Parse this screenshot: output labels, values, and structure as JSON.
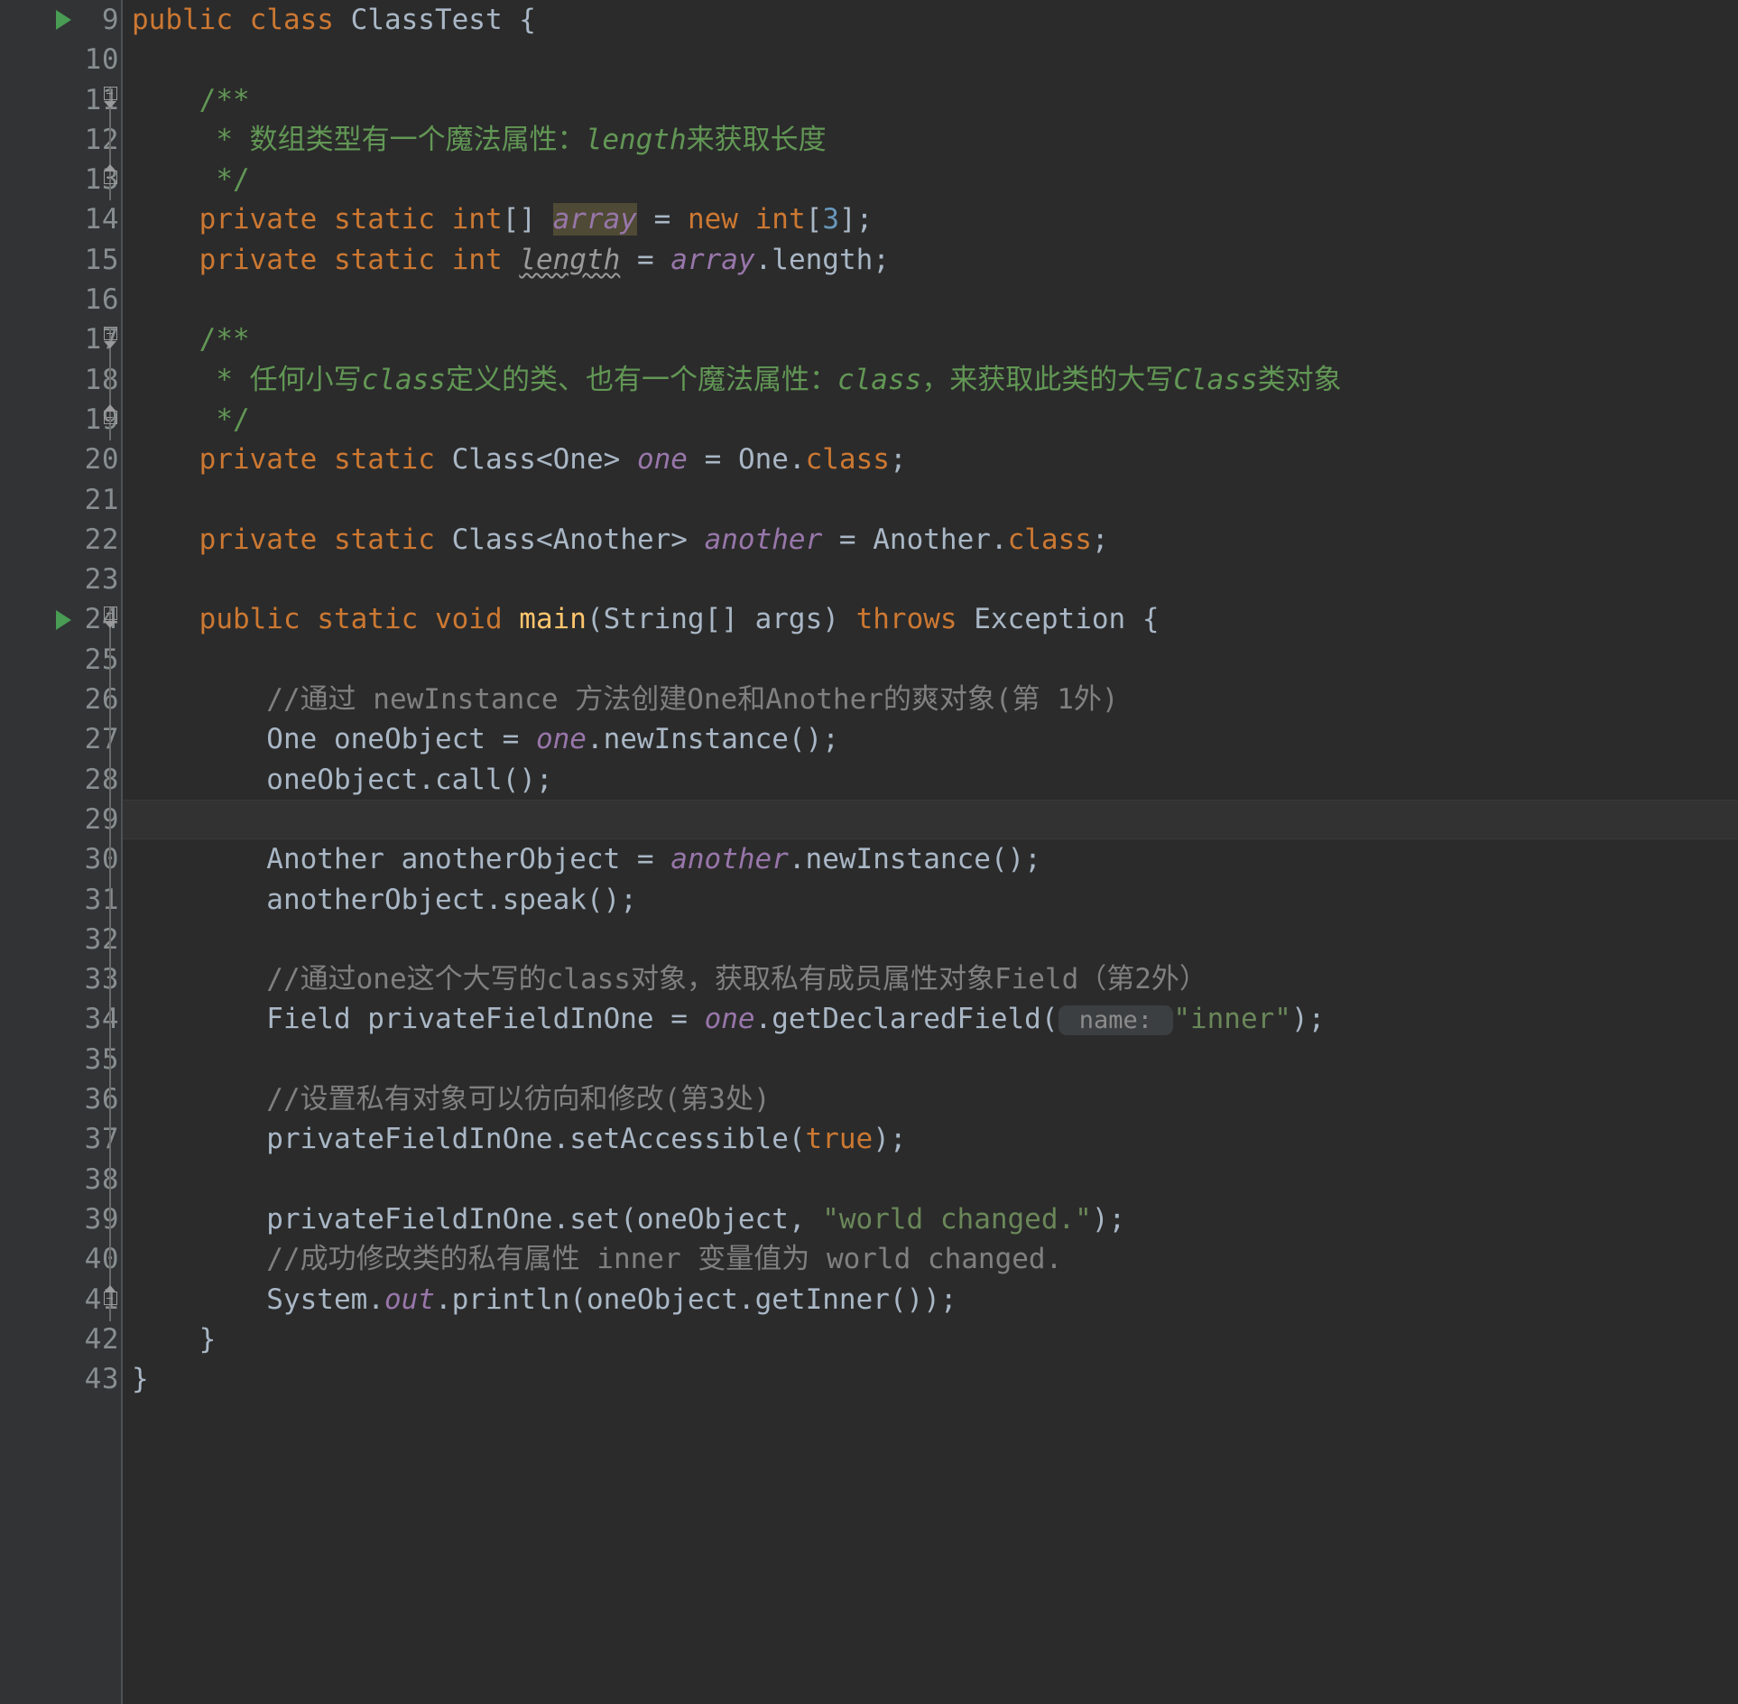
{
  "app": {
    "kind": "code-editor",
    "language": "Java",
    "theme": "Darcula",
    "class_name": "ClassTest"
  },
  "colors": {
    "background": "#2b2b2b",
    "gutter_background": "#313335",
    "line_number": "#888e8f",
    "default_text": "#a9b7c6",
    "keyword": "#cc7832",
    "number": "#6897bb",
    "string": "#6a8759",
    "line_comment": "#808080",
    "doc_comment": "#629755",
    "field_identifier": "#9876aa",
    "method_highlight": "#ffc66d",
    "identifier_highlight_bg": "#4e4a35",
    "run_marker_green": "#499c54",
    "caret_row_bg": "#323232",
    "inlay_hint_bg": "#3c3f41",
    "inlay_hint_text": "#8c8c8c"
  },
  "gutter": {
    "line_numbers": [
      "9",
      "10",
      "11",
      "12",
      "13",
      "14",
      "15",
      "16",
      "17",
      "18",
      "19",
      "20",
      "21",
      "22",
      "23",
      "24",
      "25",
      "26",
      "27",
      "28",
      "29",
      "30",
      "31",
      "32",
      "33",
      "34",
      "35",
      "36",
      "37",
      "38",
      "39",
      "40",
      "41",
      "42",
      "43"
    ],
    "run_markers_on_lines": [
      "9",
      "24"
    ],
    "fold_regions": [
      {
        "start_line": "11",
        "end_line": "13"
      },
      {
        "start_line": "17",
        "end_line": "19"
      },
      {
        "start_line": "24",
        "end_line": "42"
      }
    ]
  },
  "code": {
    "caret_line": "29",
    "lines": [
      {
        "n": "9",
        "text": "public class ClassTest {"
      },
      {
        "n": "10",
        "text": ""
      },
      {
        "n": "11",
        "text": "    /**"
      },
      {
        "n": "12",
        "text": "     * 数组类型有一个魔法属性：length来获取长度"
      },
      {
        "n": "13",
        "text": "     */"
      },
      {
        "n": "14",
        "text": "    private static int[] array = new int[3];"
      },
      {
        "n": "15",
        "text": "    private static int length = array.length;"
      },
      {
        "n": "16",
        "text": ""
      },
      {
        "n": "17",
        "text": "    /**"
      },
      {
        "n": "18",
        "text": "     * 任何小写class定义的类、也有一个魔法属性：class，来获取此类的大写Class类对象"
      },
      {
        "n": "19",
        "text": "     */"
      },
      {
        "n": "20",
        "text": "    private static Class<One> one = One.class;"
      },
      {
        "n": "21",
        "text": ""
      },
      {
        "n": "22",
        "text": "    private static Class<Another> another = Another.class;"
      },
      {
        "n": "23",
        "text": ""
      },
      {
        "n": "24",
        "text": "    public static void main(String[] args) throws Exception {"
      },
      {
        "n": "25",
        "text": ""
      },
      {
        "n": "26",
        "text": "        //通过 newInstance 方法创建One和Another的爽对象(第 1外)"
      },
      {
        "n": "27",
        "text": "        One oneObject = one.newInstance();"
      },
      {
        "n": "28",
        "text": "        oneObject.call();"
      },
      {
        "n": "29",
        "text": ""
      },
      {
        "n": "30",
        "text": "        Another anotherObject = another.newInstance();"
      },
      {
        "n": "31",
        "text": "        anotherObject.speak();"
      },
      {
        "n": "32",
        "text": ""
      },
      {
        "n": "33",
        "text": "        //通过one这个大写的class对象，获取私有成员属性对象Field（第2外）"
      },
      {
        "n": "34",
        "text": "        Field privateFieldInOne = one.getDeclaredField( name: \"inner\");"
      },
      {
        "n": "35",
        "text": ""
      },
      {
        "n": "36",
        "text": "        //设置私有对象可以彷向和修改(第3处)"
      },
      {
        "n": "37",
        "text": "        privateFieldInOne.setAccessible(true);"
      },
      {
        "n": "38",
        "text": ""
      },
      {
        "n": "39",
        "text": "        privateFieldInOne.set(oneObject, \"world changed.\");"
      },
      {
        "n": "40",
        "text": "        //成功修改类的私有属性 inner 变量值为 world changed."
      },
      {
        "n": "41",
        "text": "        System.out.println(oneObject.getInner());"
      },
      {
        "n": "42",
        "text": "    }"
      },
      {
        "n": "43",
        "text": "}"
      }
    ]
  },
  "tokens": {
    "l9": [
      {
        "t": "public",
        "c": "kw"
      },
      {
        "t": " ",
        "c": "punc"
      },
      {
        "t": "class",
        "c": "kw"
      },
      {
        "t": " ",
        "c": "punc"
      },
      {
        "t": "ClassTest",
        "c": "cls"
      },
      {
        "t": " {",
        "c": "punc"
      }
    ],
    "l11": [
      {
        "t": "    /**",
        "c": "doc"
      }
    ],
    "l12": [
      {
        "t": "     * 数组类型有一个魔法属性：",
        "c": "doc"
      },
      {
        "t": "length",
        "c": "doc-italic"
      },
      {
        "t": "来获取长度",
        "c": "doc"
      }
    ],
    "l13": [
      {
        "t": "     */",
        "c": "doc"
      }
    ],
    "l14": [
      {
        "t": "    ",
        "c": "punc"
      },
      {
        "t": "private",
        "c": "kw"
      },
      {
        "t": " ",
        "c": "punc"
      },
      {
        "t": "static",
        "c": "kw"
      },
      {
        "t": " ",
        "c": "punc"
      },
      {
        "t": "int",
        "c": "kw"
      },
      {
        "t": "[]",
        "c": "punc"
      },
      {
        "t": " ",
        "c": "punc"
      },
      {
        "t": "array",
        "c": "fld-hl"
      },
      {
        "t": " = ",
        "c": "punc"
      },
      {
        "t": "new",
        "c": "kw"
      },
      {
        "t": " ",
        "c": "punc"
      },
      {
        "t": "int",
        "c": "kw"
      },
      {
        "t": "[",
        "c": "punc"
      },
      {
        "t": "3",
        "c": "num"
      },
      {
        "t": "];",
        "c": "punc"
      }
    ],
    "l15": [
      {
        "t": "    ",
        "c": "punc"
      },
      {
        "t": "private",
        "c": "kw"
      },
      {
        "t": " ",
        "c": "punc"
      },
      {
        "t": "static",
        "c": "kw"
      },
      {
        "t": " ",
        "c": "punc"
      },
      {
        "t": "int",
        "c": "kw"
      },
      {
        "t": " ",
        "c": "punc"
      },
      {
        "t": "length",
        "c": "unused"
      },
      {
        "t": " = ",
        "c": "punc"
      },
      {
        "t": "array",
        "c": "fld"
      },
      {
        "t": ".length;",
        "c": "punc"
      }
    ],
    "l17": [
      {
        "t": "    /**",
        "c": "doc"
      }
    ],
    "l18": [
      {
        "t": "     * 任何小写",
        "c": "doc"
      },
      {
        "t": "class",
        "c": "doc-italic"
      },
      {
        "t": "定义的类、也有一个魔法属性：",
        "c": "doc"
      },
      {
        "t": "class",
        "c": "doc-italic"
      },
      {
        "t": "，来获取此类的大写",
        "c": "doc"
      },
      {
        "t": "Class",
        "c": "doc-italic"
      },
      {
        "t": "类对象",
        "c": "doc"
      }
    ],
    "l19": [
      {
        "t": "     */",
        "c": "doc"
      }
    ],
    "l20": [
      {
        "t": "    ",
        "c": "punc"
      },
      {
        "t": "private",
        "c": "kw"
      },
      {
        "t": " ",
        "c": "punc"
      },
      {
        "t": "static",
        "c": "kw"
      },
      {
        "t": " ",
        "c": "punc"
      },
      {
        "t": "Class<One> ",
        "c": "cls"
      },
      {
        "t": "one",
        "c": "fld"
      },
      {
        "t": " = ",
        "c": "punc"
      },
      {
        "t": "One.",
        "c": "cls"
      },
      {
        "t": "class",
        "c": "kw"
      },
      {
        "t": ";",
        "c": "punc"
      }
    ],
    "l22": [
      {
        "t": "    ",
        "c": "punc"
      },
      {
        "t": "private",
        "c": "kw"
      },
      {
        "t": " ",
        "c": "punc"
      },
      {
        "t": "static",
        "c": "kw"
      },
      {
        "t": " ",
        "c": "punc"
      },
      {
        "t": "Class<Another> ",
        "c": "cls"
      },
      {
        "t": "another",
        "c": "fld"
      },
      {
        "t": " = ",
        "c": "punc"
      },
      {
        "t": "Another.",
        "c": "cls"
      },
      {
        "t": "class",
        "c": "kw"
      },
      {
        "t": ";",
        "c": "punc"
      }
    ],
    "l24": [
      {
        "t": "    ",
        "c": "punc"
      },
      {
        "t": "public",
        "c": "kw"
      },
      {
        "t": " ",
        "c": "punc"
      },
      {
        "t": "static",
        "c": "kw"
      },
      {
        "t": " ",
        "c": "punc"
      },
      {
        "t": "void",
        "c": "kw"
      },
      {
        "t": " ",
        "c": "punc"
      },
      {
        "t": "main",
        "c": "mainhl"
      },
      {
        "t": "(String[] args) ",
        "c": "cls"
      },
      {
        "t": "throws",
        "c": "kw"
      },
      {
        "t": " Exception {",
        "c": "cls"
      }
    ],
    "l26": [
      {
        "t": "        //通过 newInstance 方法创建One和Another的爽对象(第 1外)",
        "c": "cmt"
      }
    ],
    "l27": [
      {
        "t": "        One oneObject = ",
        "c": "cls"
      },
      {
        "t": "one",
        "c": "fld"
      },
      {
        "t": ".newInstance();",
        "c": "cls"
      }
    ],
    "l28": [
      {
        "t": "        oneObject.call();",
        "c": "cls"
      }
    ],
    "l30": [
      {
        "t": "        Another anotherObject = ",
        "c": "cls"
      },
      {
        "t": "another",
        "c": "fld"
      },
      {
        "t": ".newInstance();",
        "c": "cls"
      }
    ],
    "l31": [
      {
        "t": "        anotherObject.speak();",
        "c": "cls"
      }
    ],
    "l33": [
      {
        "t": "        //通过one这个大写的class对象，获取私有成员属性对象Field（第2外）",
        "c": "cmt"
      }
    ],
    "l34": [
      {
        "t": "        Field privateFieldInOne = ",
        "c": "cls"
      },
      {
        "t": "one",
        "c": "fld"
      },
      {
        "t": ".getDeclaredField(",
        "c": "cls"
      },
      {
        "t": " name: ",
        "c": "hint"
      },
      {
        "t": "\"inner\"",
        "c": "str"
      },
      {
        "t": ");",
        "c": "cls"
      }
    ],
    "l36": [
      {
        "t": "        //设置私有对象可以彷向和修改(第3处)",
        "c": "cmt"
      }
    ],
    "l37": [
      {
        "t": "        privateFieldInOne.setAccessible(",
        "c": "cls"
      },
      {
        "t": "true",
        "c": "kw"
      },
      {
        "t": ");",
        "c": "cls"
      }
    ],
    "l39": [
      {
        "t": "        privateFieldInOne.set(oneObject, ",
        "c": "cls"
      },
      {
        "t": "\"world changed.\"",
        "c": "str"
      },
      {
        "t": ");",
        "c": "cls"
      }
    ],
    "l40": [
      {
        "t": "        //成功修改类的私有属性 inner 变量值为 world changed.",
        "c": "cmt"
      }
    ],
    "l41": [
      {
        "t": "        System.",
        "c": "cls"
      },
      {
        "t": "out",
        "c": "fld"
      },
      {
        "t": ".println(oneObject.getInner());",
        "c": "cls"
      }
    ],
    "l42": [
      {
        "t": "    }",
        "c": "punc"
      }
    ],
    "l43": [
      {
        "t": "}",
        "c": "punc"
      }
    ]
  }
}
